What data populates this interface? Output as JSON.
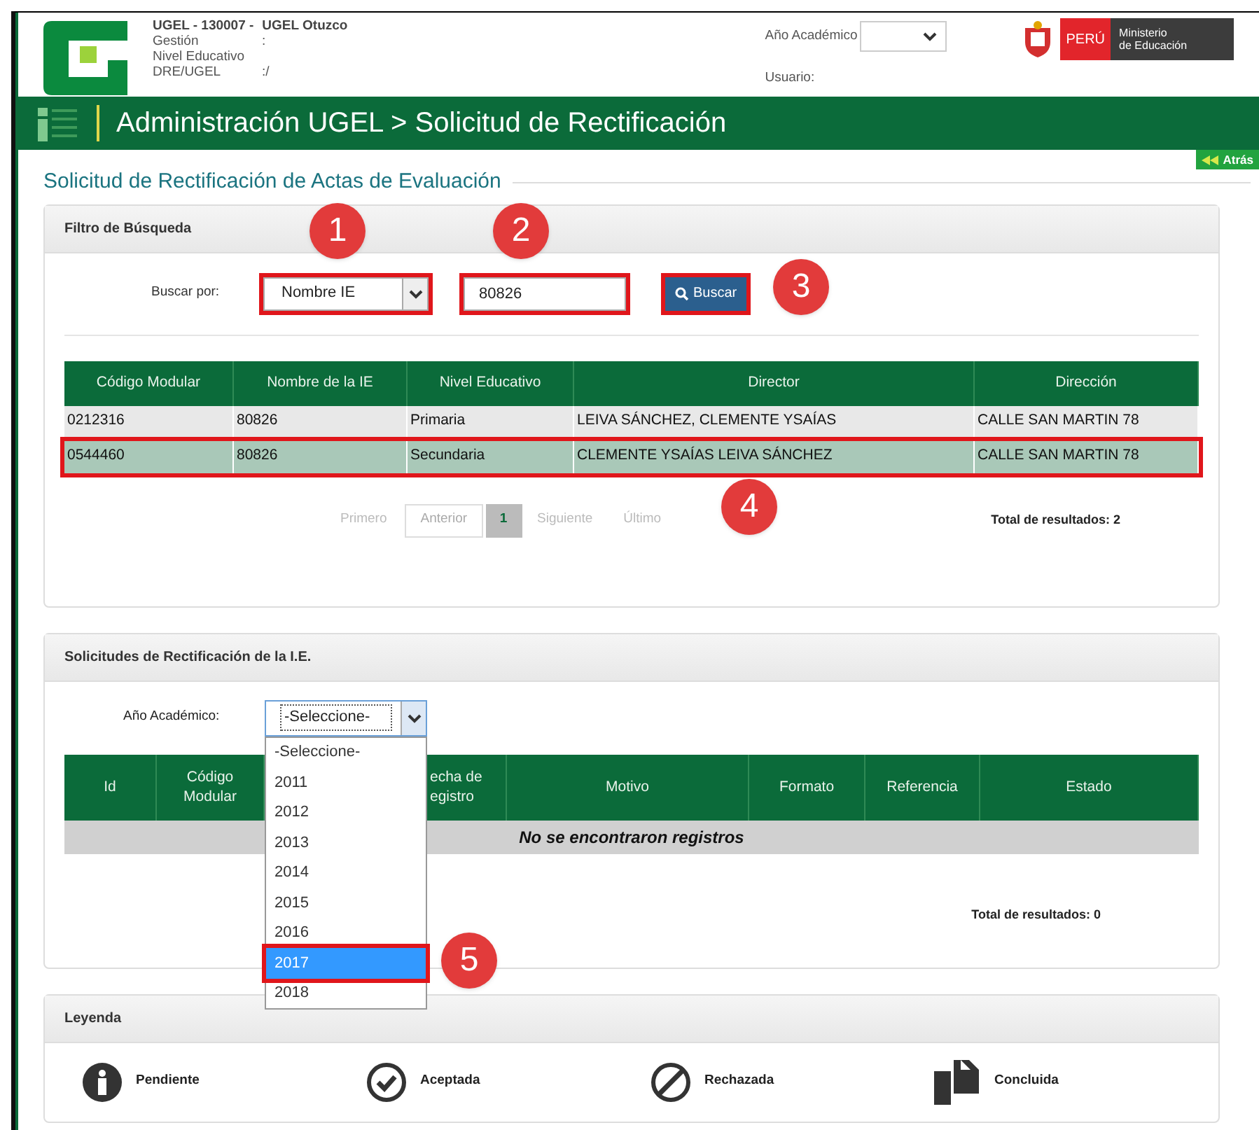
{
  "header": {
    "info": [
      {
        "label": "UGEL - 130007 -",
        "value": "UGEL Otuzco"
      },
      {
        "label": "Gestión",
        "value": ":"
      },
      {
        "label": "Nivel Educativo"
      },
      {
        "label": "DRE/UGEL",
        "value": ":/"
      }
    ],
    "year_label": "Año Académico",
    "user_label": "Usuario:",
    "brand": "PERÚ",
    "ministry": [
      "Ministerio",
      "de Educación"
    ]
  },
  "nav": {
    "title": "Administración UGEL > Solicitud de Rectificación",
    "back": "Atrás"
  },
  "page_title": "Solicitud de Rectificación de Actas de Evaluación",
  "filter": {
    "title": "Filtro de Búsqueda",
    "label": "Buscar por:",
    "select": {
      "value": "Nombre IE",
      "highlighted": true
    },
    "input": {
      "value": "80826",
      "highlighted": true
    },
    "button": {
      "label": "Buscar",
      "highlighted": true
    },
    "table": {
      "columns": [
        "Código Modular",
        "Nombre de la IE",
        "Nivel Educativo",
        "Director",
        "Dirección"
      ],
      "rows": [
        {
          "cells": [
            "0212316",
            "80826",
            "Primaria",
            "LEIVA SÁNCHEZ, CLEMENTE YSAÍAS",
            "CALLE SAN MARTIN 78"
          ],
          "selected": false,
          "highlighted": false
        },
        {
          "cells": [
            "0544460",
            "80826",
            "Secundaria",
            "CLEMENTE YSAÍAS LEIVA SÁNCHEZ",
            "CALLE SAN MARTIN 78"
          ],
          "selected": true,
          "highlighted": true
        }
      ]
    },
    "pagination": [
      {
        "label": "Primero",
        "kind": "text"
      },
      {
        "label": "Anterior",
        "kind": "box"
      },
      {
        "label": "1",
        "kind": "current"
      },
      {
        "label": "Siguiente",
        "kind": "text"
      },
      {
        "label": "Último",
        "kind": "text"
      }
    ],
    "total": "Total de resultados: 2"
  },
  "requests": {
    "title": "Solicitudes de Rectificación de la I.E.",
    "label": "Año Académico:",
    "select": {
      "value": "-Seleccione-",
      "expanded": true
    },
    "options": [
      {
        "label": "-Seleccione-",
        "selected": false,
        "highlighted": false
      },
      {
        "label": "2011",
        "selected": false,
        "highlighted": false
      },
      {
        "label": "2012",
        "selected": false,
        "highlighted": false
      },
      {
        "label": "2013",
        "selected": false,
        "highlighted": false
      },
      {
        "label": "2014",
        "selected": false,
        "highlighted": false
      },
      {
        "label": "2015",
        "selected": false,
        "highlighted": false
      },
      {
        "label": "2016",
        "selected": false,
        "highlighted": false
      },
      {
        "label": "2017",
        "selected": true,
        "highlighted": true
      },
      {
        "label": "2018",
        "selected": false,
        "highlighted": false
      }
    ],
    "table": {
      "columns": [
        "Id",
        "Código Modular",
        "echa de egistro",
        "Motivo",
        "Formato",
        "Referencia",
        "Estado"
      ],
      "empty": "No se encontraron registros"
    },
    "total": "Total de resultados: 0"
  },
  "legend": {
    "title": "Leyenda",
    "items": [
      {
        "label": "Pendiente",
        "kind": "info"
      },
      {
        "label": "Aceptada",
        "kind": "check"
      },
      {
        "label": "Rechazada",
        "kind": "ban"
      },
      {
        "label": "Concluida",
        "kind": "files"
      }
    ]
  },
  "callouts": [
    {
      "number": "1"
    },
    {
      "number": "2"
    },
    {
      "number": "3"
    },
    {
      "number": "4"
    },
    {
      "number": "5"
    }
  ]
}
